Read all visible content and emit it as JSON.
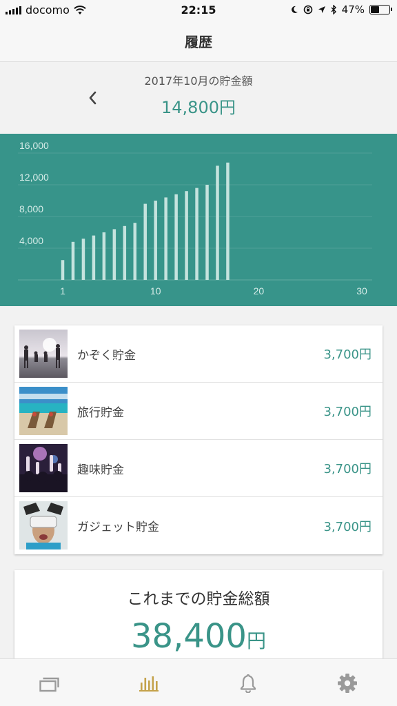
{
  "status_bar": {
    "carrier": "docomo",
    "time": "22:15",
    "battery": "47%",
    "battery_level": 0.47
  },
  "header": {
    "title": "履歴"
  },
  "month": {
    "label": "2017年10月の貯金額",
    "amount": "14,800円",
    "back_icon": "chevron-left-icon"
  },
  "colors": {
    "accent": "#3a9488",
    "chart_bg": "#37948a",
    "bar": "#c5e3de",
    "tab_active": "#c4a24a",
    "tab_inactive": "#9a9a9a"
  },
  "chart_data": {
    "type": "bar",
    "title": "",
    "xlabel": "",
    "ylabel": "",
    "ylim": [
      0,
      16000
    ],
    "xlim": [
      1,
      31
    ],
    "y_ticks": [
      "4,000",
      "8,000",
      "12,000",
      "16,000"
    ],
    "y_tick_values": [
      4000,
      8000,
      12000,
      16000
    ],
    "x_ticks": [
      "1",
      "10",
      "20",
      "30"
    ],
    "x_tick_values": [
      1,
      10,
      20,
      30
    ],
    "grid": true,
    "x": [
      1,
      2,
      3,
      4,
      5,
      6,
      7,
      8,
      9,
      10,
      11,
      12,
      13,
      14,
      15,
      16,
      17
    ],
    "values": [
      2500,
      4800,
      5200,
      5600,
      6000,
      6400,
      6800,
      7200,
      9600,
      10000,
      10400,
      10800,
      11200,
      11600,
      12000,
      14400,
      14800
    ]
  },
  "goals": [
    {
      "name": "かぞく貯金",
      "amount": "3,700円",
      "image": "family-beach-photo"
    },
    {
      "name": "旅行貯金",
      "amount": "3,700円",
      "image": "beach-chairs-photo"
    },
    {
      "name": "趣味貯金",
      "amount": "3,700円",
      "image": "concert-crowd-photo"
    },
    {
      "name": "ガジェット貯金",
      "amount": "3,700円",
      "image": "vr-headset-photo"
    }
  ],
  "total": {
    "label": "これまでの貯金総額",
    "amount": "38,400",
    "unit": "円"
  },
  "tabs": [
    {
      "icon": "cards-icon",
      "active": false
    },
    {
      "icon": "bar-chart-icon",
      "active": true
    },
    {
      "icon": "bell-icon",
      "active": false
    },
    {
      "icon": "gear-icon",
      "active": false
    }
  ]
}
